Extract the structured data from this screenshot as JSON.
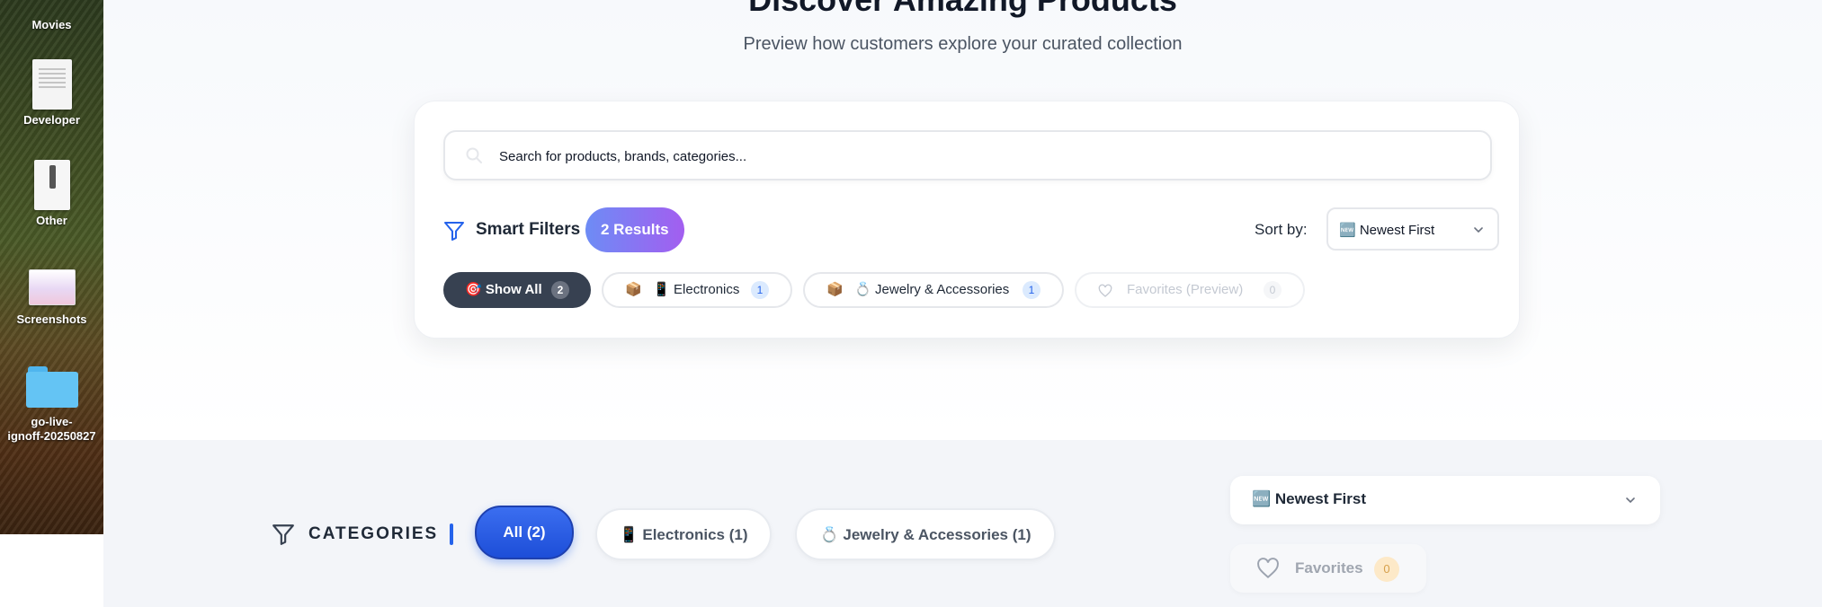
{
  "desktop": {
    "items": [
      {
        "label": "Movies"
      },
      {
        "label": "Developer"
      },
      {
        "label": "Other"
      },
      {
        "label": "Screenshots"
      },
      {
        "label_line1": "go-live-",
        "label_line2": "ignoff-20250827"
      }
    ]
  },
  "hero": {
    "title": "Discover Amazing Products",
    "subtitle": "Preview how customers explore your curated collection"
  },
  "search": {
    "placeholder": "Search for products, brands, categories..."
  },
  "filters": {
    "label": "Smart Filters",
    "results": "2 Results",
    "sort_label": "Sort by:",
    "sort_value": "🆕 Newest First"
  },
  "chips": [
    {
      "label": "🎯 Show All",
      "count": "2"
    },
    {
      "label": "📦   📱 Electronics",
      "count": "1"
    },
    {
      "label": "📦   💍 Jewelry & Accessories",
      "count": "1"
    },
    {
      "label": "Favorites (Preview)",
      "count": "0"
    }
  ],
  "categories": {
    "label": "CATEGORIES",
    "buttons": [
      {
        "label": "All (2)"
      },
      {
        "label": "📱 Electronics (1)"
      },
      {
        "label": "💍 Jewelry & Accessories (1)"
      }
    ]
  },
  "sidebar_controls": {
    "sort_value": "🆕 Newest First",
    "favorites_label": "Favorites",
    "favorites_count": "0"
  },
  "colors": {
    "accent": "#2563eb",
    "badge_start": "#6d8cf5",
    "badge_end": "#a35ef0",
    "dark_chip": "#374151"
  }
}
